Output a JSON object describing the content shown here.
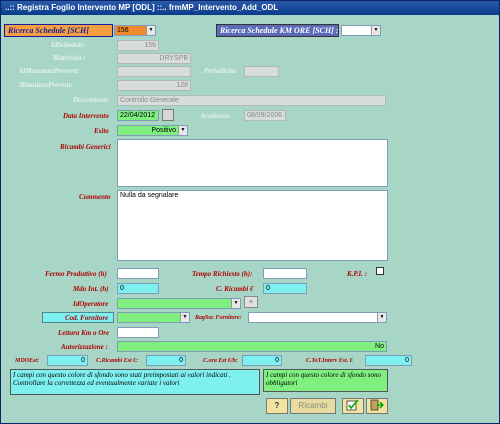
{
  "window": {
    "title": "..:: Registra Foglio Intervento MP [ODL] ::..   frmMP_Intervento_Add_ODL"
  },
  "header": {
    "ricerca_schedule_label": "Ricerca Schedule [SCH]",
    "ricerca_schedule_value": "156",
    "ricerca_km_label": "Ricerca Schedule KM ORE  [SCH] :",
    "ricerca_km_value": ""
  },
  "fields": {
    "idschedule_label": "IdSchedule:",
    "idschedule_value": "156",
    "matricola_label": "Matricola :",
    "matricola_value": "DRYSPB",
    "idmanutenzione_label": "IdManutenzPrevent:",
    "periodicita_label": "Periodicità:",
    "manutenzione_label": "ManutenzPrevent:",
    "manutenzione_value": "128",
    "descrizione_label": "Descrizione:",
    "descrizione_value": "Controllo Generale",
    "data_intervento_label": "Data Intervento",
    "data_intervento_value": "22/04/2012",
    "scadenza_label": "Scadenza:",
    "scadenza_value": "08/09/2006",
    "esito_label": "Esito",
    "esito_value": "Positivo",
    "ricambi_label": "Ricambi Generici",
    "ricambi_value": "",
    "commento_label": "Commento",
    "commento_value": "Nulla da segnalare",
    "fermo_label": "Fermo Produttivo (h)",
    "fermo_value": "",
    "tempo_label": "Tempo Richiesto (h):",
    "tempo_value": "",
    "kpi_label": "K.P.I. :",
    "mdo_label": "Mdo Int. (h)",
    "mdo_value": "0",
    "c_ricambi_label": "C. Ricambi €",
    "c_ricambi_value": "0",
    "idoperatore_label": "IdOperatore",
    "idoperatore_value": "",
    "cod_fornitore_label": "Cod. Fornitore",
    "cod_fornitore_value": "",
    "ragsoc_label": "RagSoc Fornitore:",
    "ragsoc_value": "",
    "lettura_label": "Lettura Km o Ore",
    "lettura_value": "",
    "autorizzazione_label": "Autorizzazione :",
    "autorizzazione_value": "No",
    "mdoest_label": "MDOEst:",
    "mdoest_value": "0",
    "c_ricambi_est_label": "C.Ricambi Est €:",
    "c_ricambi_est_value": "0",
    "c_ora_est_label": "C.ora Est €/h:",
    "c_ora_est_value": "0",
    "c_tot_label": "C.ToT.Interv Est. €",
    "c_tot_value": "0"
  },
  "notes": {
    "cyan_note": "I campi con questo colore di sfondo sono stati preimpostati ai valori indicati . Controllare la correttezza ed eventualmente variate i valori",
    "green_note": "I campi con questo colore di sfondo sono obbligatori"
  },
  "toolbar": {
    "help_label": "?",
    "ricambi_label": "Ricambi"
  },
  "colors": {
    "background": "#a8d6c6",
    "mandatory": "#7ff07f",
    "preset": "#7ff0f0",
    "active_search": "#f08a2c"
  },
  "icons": {
    "help": "question-icon",
    "confirm": "confirm-icon",
    "exit": "exit-icon"
  }
}
